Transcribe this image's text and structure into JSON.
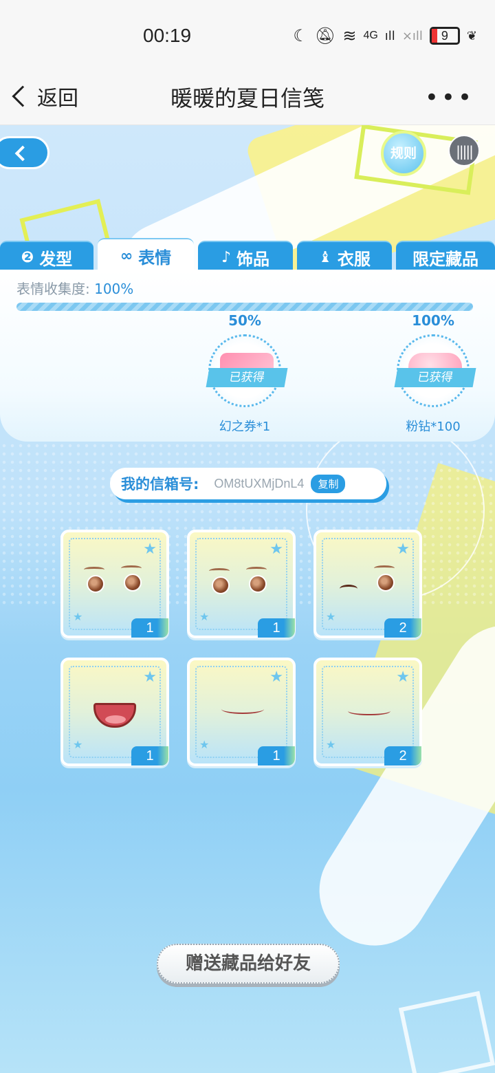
{
  "status_bar": {
    "time": "00:19",
    "battery": "9",
    "network": "4G"
  },
  "nav": {
    "back_label": "返回",
    "title": "暖暖的夏日信笺",
    "more": "•••"
  },
  "game": {
    "rule_label": "规则",
    "tabs": [
      {
        "label": "发型",
        "icon": "hair-icon",
        "active": false
      },
      {
        "label": "表情",
        "icon": "mask-icon",
        "active": true
      },
      {
        "label": "饰品",
        "icon": "accessory-icon",
        "active": false
      },
      {
        "label": "衣服",
        "icon": "clothes-icon",
        "active": false
      },
      {
        "label": "限定藏品",
        "icon": "",
        "active": false
      }
    ],
    "collection": {
      "label": "表情收集度: ",
      "value": "100%",
      "progress": 1.0
    },
    "milestones": [
      {
        "percent": "50%",
        "status": "已获得",
        "reward": "幻之券*1"
      },
      {
        "percent": "100%",
        "status": "已获得",
        "reward": "粉钻*100"
      }
    ],
    "mailbox": {
      "label": "我的信箱号:",
      "code": "OM8tUXMjDnL4",
      "copy_label": "复制"
    },
    "items": [
      {
        "type": "eyes",
        "count": "1"
      },
      {
        "type": "eyes",
        "count": "1"
      },
      {
        "type": "eyes-wink",
        "count": "2"
      },
      {
        "type": "mouth-open",
        "count": "1"
      },
      {
        "type": "mouth-smile",
        "count": "1"
      },
      {
        "type": "mouth-wavy",
        "count": "2"
      }
    ],
    "gift_button": "赠送藏品给好友"
  }
}
